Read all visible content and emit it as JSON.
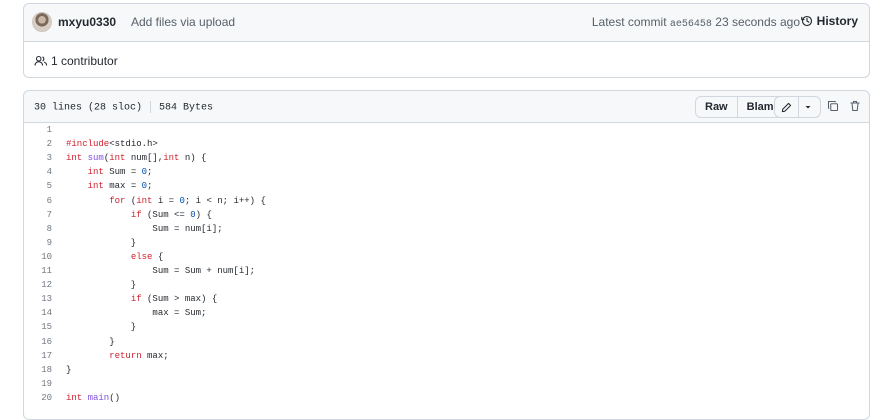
{
  "commit": {
    "author": "mxyu0330",
    "message": "Add files via upload",
    "latest_label": "Latest commit",
    "sha": "ae56458",
    "time": "23 seconds ago",
    "history_label": "History",
    "contributors_label": "1 contributor"
  },
  "file": {
    "lines_info": "30 lines (28 sloc)",
    "size": "584 Bytes",
    "raw_label": "Raw",
    "blame_label": "Blame"
  },
  "icons": [
    "avatar",
    "history-icon",
    "people-icon",
    "pencil-icon",
    "chevron-down-icon",
    "copy-icon",
    "trash-icon"
  ],
  "colors": {
    "keyword": "#cf222e",
    "function": "#8250df",
    "number": "#0550ae",
    "string": "#0a3069",
    "text": "#24292f"
  },
  "code": [
    {
      "n": "1",
      "t": ""
    },
    {
      "n": "2",
      "t": "#include<stdio.h>"
    },
    {
      "n": "3",
      "t": "int sum(int num[],int n) {"
    },
    {
      "n": "4",
      "t": "    int Sum = 0;"
    },
    {
      "n": "5",
      "t": "    int max = 0;"
    },
    {
      "n": "6",
      "t": "        for (int i = 0; i < n; i++) {"
    },
    {
      "n": "7",
      "t": "            if (Sum <= 0) {"
    },
    {
      "n": "8",
      "t": "                Sum = num[i];"
    },
    {
      "n": "9",
      "t": "            }"
    },
    {
      "n": "10",
      "t": "            else {"
    },
    {
      "n": "11",
      "t": "                Sum = Sum + num[i];"
    },
    {
      "n": "12",
      "t": "            }"
    },
    {
      "n": "13",
      "t": "            if (Sum > max) {"
    },
    {
      "n": "14",
      "t": "                max = Sum;"
    },
    {
      "n": "15",
      "t": "            }"
    },
    {
      "n": "16",
      "t": "        }"
    },
    {
      "n": "17",
      "t": "        return max;"
    },
    {
      "n": "18",
      "t": "}"
    },
    {
      "n": "19",
      "t": ""
    },
    {
      "n": "20",
      "t": "int main()"
    }
  ]
}
